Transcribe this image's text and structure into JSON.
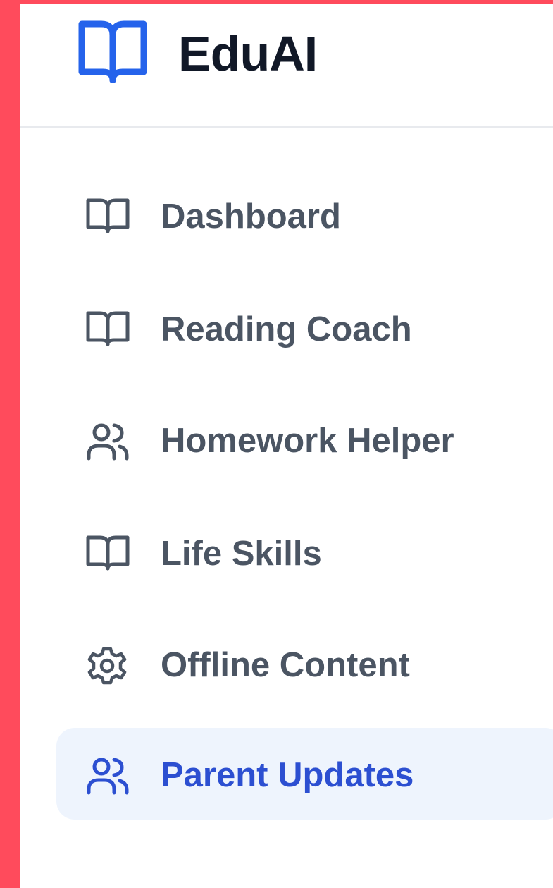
{
  "app": {
    "brand": "EduAI",
    "colors": {
      "accent": "#2c4fd1",
      "logo": "#2563eb",
      "text": "#4b5563",
      "brand_text": "#111827",
      "active_bg": "#eef4fd",
      "frame": "#ff4b5c"
    }
  },
  "sidebar": {
    "items": [
      {
        "label": "Dashboard",
        "icon": "book-open-icon",
        "active": false
      },
      {
        "label": "Reading Coach",
        "icon": "book-open-icon",
        "active": false
      },
      {
        "label": "Homework Helper",
        "icon": "users-icon",
        "active": false
      },
      {
        "label": "Life Skills",
        "icon": "book-open-icon",
        "active": false
      },
      {
        "label": "Offline Content",
        "icon": "gear-icon",
        "active": false
      },
      {
        "label": "Parent Updates",
        "icon": "users-icon",
        "active": true
      }
    ]
  }
}
